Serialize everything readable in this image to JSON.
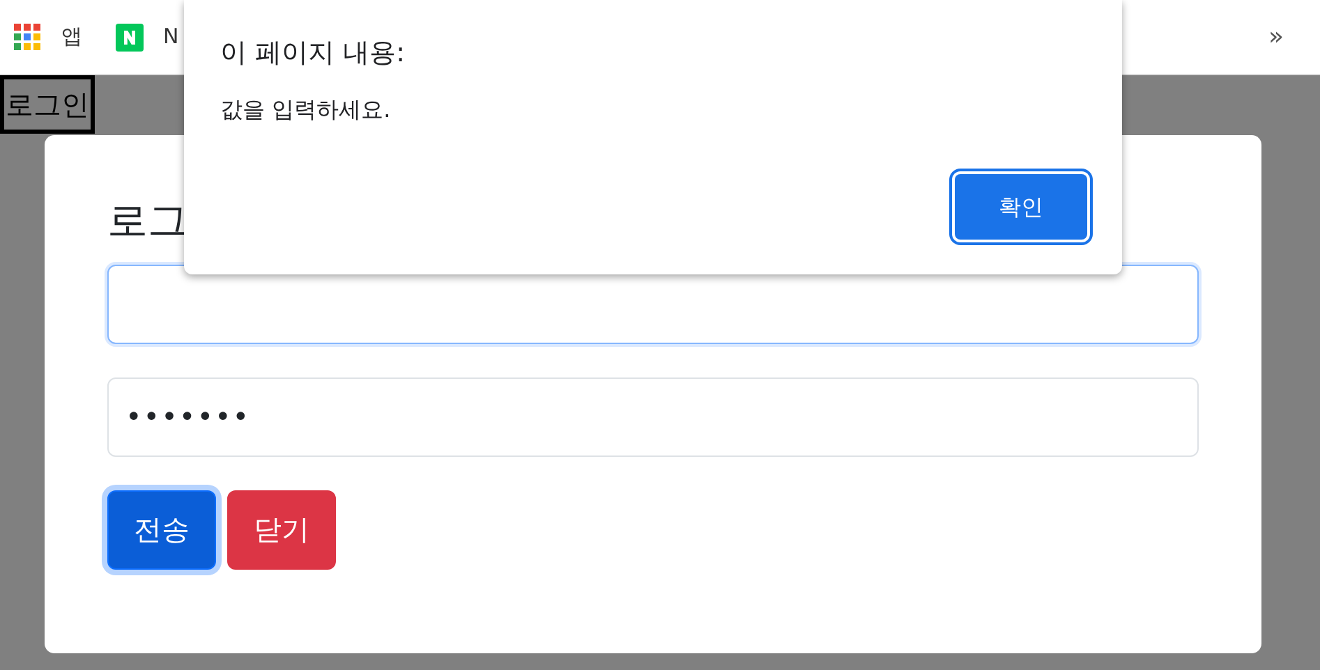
{
  "bookmarks_bar": {
    "items": [
      {
        "kind": "apps",
        "label": "앱"
      },
      {
        "kind": "site",
        "label": "N"
      }
    ],
    "overflow": "»"
  },
  "page": {
    "login_button": "로그인"
  },
  "modal": {
    "title": "로그",
    "fields": [
      {
        "kind": "text",
        "focused": true
      },
      {
        "kind": "password",
        "value": "•••••••",
        "focused": false
      }
    ],
    "buttons": [
      {
        "label": "전송",
        "kind": "submit",
        "focused": true
      },
      {
        "label": "닫기",
        "kind": "close",
        "focused": false
      }
    ]
  },
  "alert_dialog": {
    "title": "이 페이지 내용:",
    "message": "값을 입력하세요.",
    "button": {
      "label": "확인",
      "focused": true
    }
  }
}
